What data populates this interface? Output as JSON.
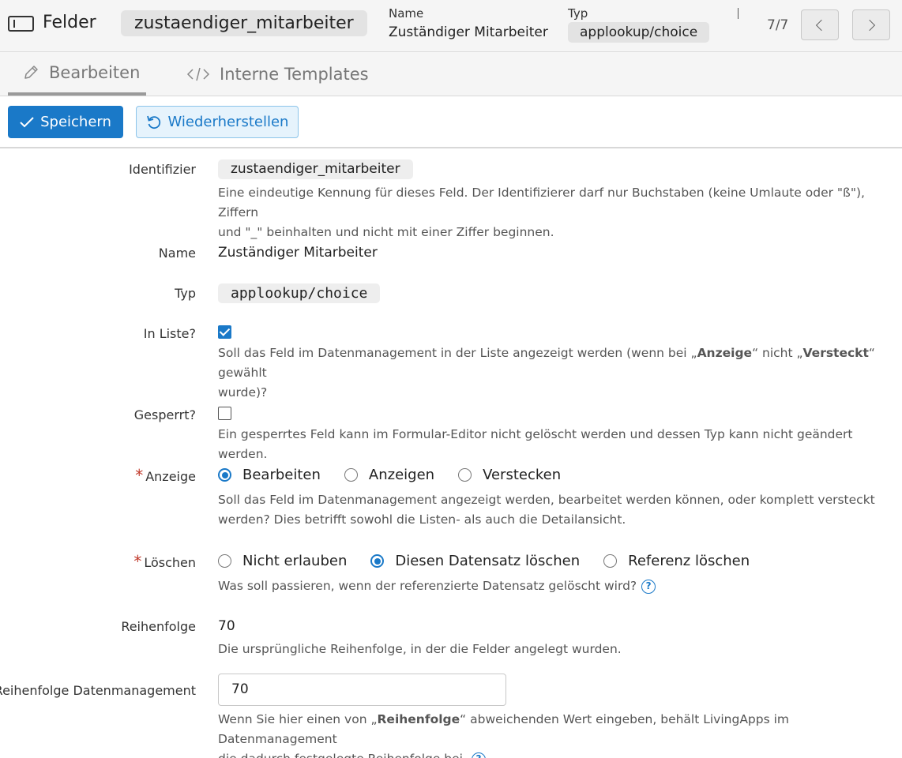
{
  "header": {
    "title": "Felder",
    "identifier_chip": "zustaendiger_mitarbeiter",
    "name_label": "Name",
    "name_value": "Zuständiger Mitarbeiter",
    "type_label": "Typ",
    "type_value": "applookup/choice",
    "pager": "7/7"
  },
  "tabs": [
    {
      "label": "Bearbeiten",
      "active": true,
      "icon": "pencil-icon"
    },
    {
      "label": "Interne Templates",
      "active": false,
      "icon": "code-icon"
    }
  ],
  "toolbar": {
    "save_label": "Speichern",
    "restore_label": "Wiederherstellen"
  },
  "form": {
    "identifier": {
      "label": "Identifizier",
      "value": "zustaendiger_mitarbeiter",
      "help_line1": "Eine eindeutige Kennung für dieses Feld. Der Identifizierer darf nur Buchstaben (keine Umlaute oder \"ß\"), Ziffern",
      "help_line2": "und \"_\" beinhalten und nicht mit einer Ziffer beginnen."
    },
    "name": {
      "label": "Name",
      "value": "Zuständiger Mitarbeiter"
    },
    "type": {
      "label": "Typ",
      "value": "applookup/choice"
    },
    "in_list": {
      "label": "In Liste?",
      "checked": true,
      "help_pre": "Soll das Feld im Datenmanagement in der Liste angezeigt werden (wenn bei „",
      "help_b1": "Anzeige",
      "help_mid": "“ nicht „",
      "help_b2": "Versteckt",
      "help_post": "“ gewählt",
      "help_line2": "wurde)?"
    },
    "locked": {
      "label": "Gesperrt?",
      "checked": false,
      "help": "Ein gesperrtes Feld kann im Formular-Editor nicht gelöscht werden und dessen Typ kann nicht geändert werden."
    },
    "display": {
      "required_mark": "*",
      "label": "Anzeige",
      "options": [
        "Bearbeiten",
        "Anzeigen",
        "Verstecken"
      ],
      "selected": "Bearbeiten",
      "help_line1": "Soll das Feld im Datenmanagement angezeigt werden, bearbeitet werden können, oder komplett versteckt",
      "help_line2": "werden? Dies betrifft sowohl die Listen- als auch die Detailansicht."
    },
    "delete": {
      "required_mark": "*",
      "label": "Löschen",
      "options": [
        "Nicht erlauben",
        "Diesen Datensatz löschen",
        "Referenz löschen"
      ],
      "selected": "Diesen Datensatz löschen",
      "help": "Was soll passieren, wenn der referenzierte Datensatz gelöscht wird?"
    },
    "order": {
      "label": "Reihenfolge",
      "value": "70",
      "help": "Die ursprüngliche Reihenfolge, in der die Felder angelegt wurden."
    },
    "order_dm": {
      "label": "Reihenfolge Datenmanagement",
      "value": "70",
      "help_pre": "Wenn Sie hier einen von „",
      "help_b": "Reihenfolge",
      "help_post": "“ abweichenden Wert eingeben, behält LivingApps im Datenmanagement",
      "help_line2": "die dadurch festgelegte Reihenfolge bei."
    }
  },
  "colors": {
    "accent": "#1a79c8",
    "required": "#c0392b"
  }
}
